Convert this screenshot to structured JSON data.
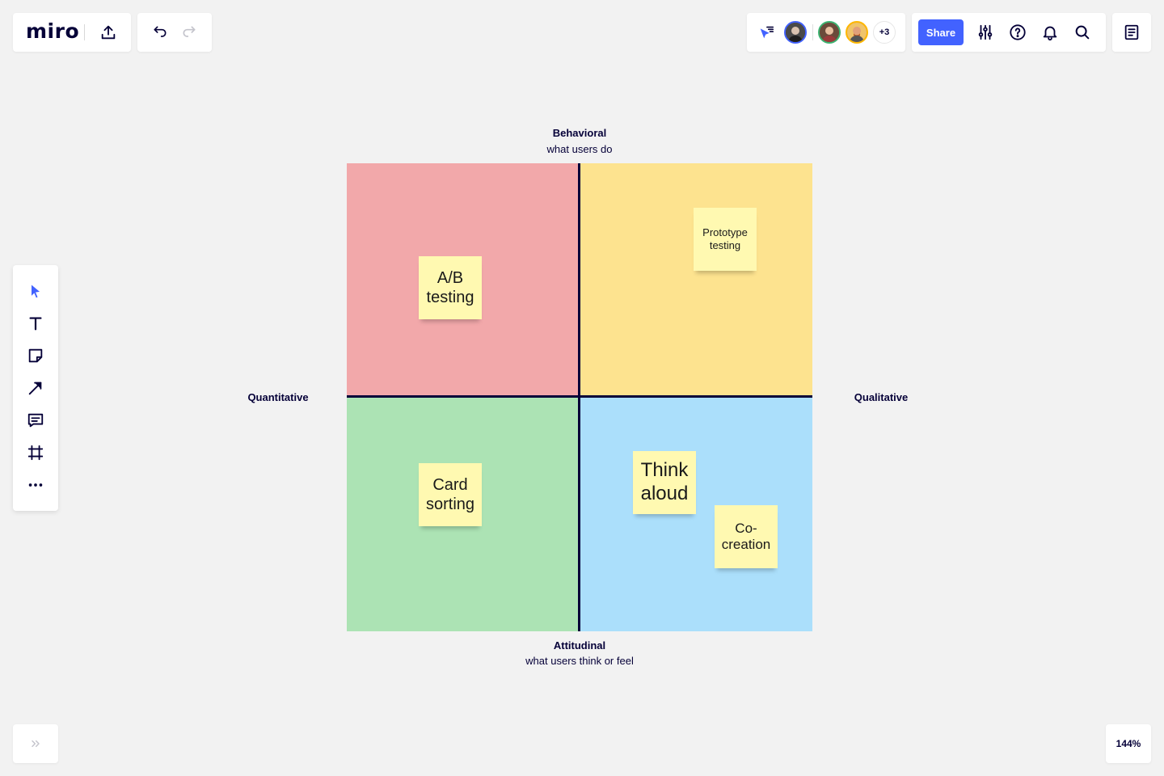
{
  "app": {
    "logo": "miro"
  },
  "collaborators": {
    "more_count": "+3"
  },
  "toolbar_top": {
    "share_label": "Share"
  },
  "zoom": {
    "level": "144%"
  },
  "board": {
    "axis_top": {
      "title": "Behavioral",
      "subtitle": "what users do"
    },
    "axis_bottom": {
      "title": "Attitudinal",
      "subtitle": "what users think or feel"
    },
    "axis_left": "Quantitative",
    "axis_right": "Qualitative",
    "quadrant_colors": {
      "top_left": "#f2a8aa",
      "top_right": "#fde38f",
      "bottom_left": "#ace3b4",
      "bottom_right": "#abdffb"
    },
    "stickies": {
      "ab_testing": "A/B testing",
      "prototype_testing": "Prototype testing",
      "card_sorting": "Card sorting",
      "think_aloud": "Think aloud",
      "co_creation": "Co-creation"
    }
  },
  "colors": {
    "accent": "#4262ff",
    "text": "#050038",
    "sticky": "#fff9b1"
  }
}
